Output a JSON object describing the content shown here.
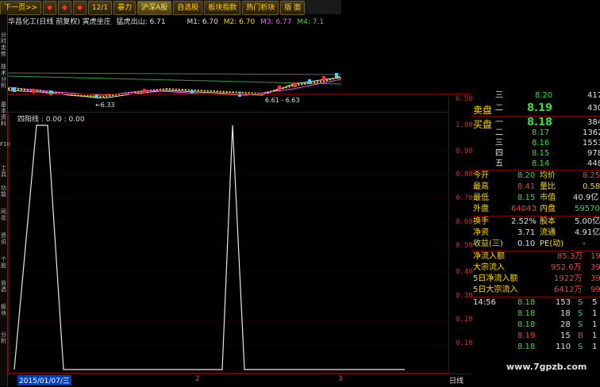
{
  "toolbar": {
    "items": [
      "下一页>>",
      "◆",
      "◆",
      "◆",
      "12/1",
      "暴力",
      "沪深A股",
      "自选股",
      "板块指数",
      "热门析块",
      "版 面"
    ]
  },
  "left_tabs": [
    "分时走势",
    "技术分析",
    "基本资料",
    "F10",
    "工具",
    "功能",
    "同花",
    "资讯",
    "个股",
    "自选",
    "板块",
    "分析"
  ],
  "chart_header": {
    "stock": "华昌化工(日线 前复权) 寅虎坐庄",
    "indicator": "猛虎出山: 6.71",
    "m1": "M1: 6.70",
    "m2": "M2: 6.70",
    "m3": "M3: 6.77",
    "m4": "M4: 7.1"
  },
  "price_axis": {
    "top": "6.50"
  },
  "annotations": {
    "low": "←6.33",
    "range": "6.61 - 6.63"
  },
  "lower_panel": {
    "title": "四阳线 : 0.00 : 0.00",
    "axis": [
      "1.00",
      "0.90",
      "0.80",
      "0.70",
      "0.60",
      "0.50",
      "0.40",
      "0.30",
      "0.20",
      "0.10"
    ],
    "date": "2015/01/07/三",
    "ticks": [
      "2",
      "3"
    ],
    "period": "日线"
  },
  "chart_data": {
    "type": "line",
    "series": [
      {
        "values": [
          0,
          1,
          1,
          0,
          0,
          0,
          0,
          0,
          0,
          1,
          0,
          0,
          0,
          0
        ]
      }
    ],
    "ylim": [
      0,
      1.0
    ]
  },
  "quote": {
    "sell_label": "卖盘",
    "buy_label": "买盘",
    "sell": [
      {
        "lvl": "三",
        "price": "8.20",
        "vol": "417"
      },
      {
        "lvl": "二",
        "price": "8.19",
        "vol": "430"
      }
    ],
    "buy": [
      {
        "lvl": "一",
        "price": "8.18",
        "vol": "384"
      },
      {
        "lvl": "二",
        "price": "8.17",
        "vol": "1362"
      },
      {
        "lvl": "三",
        "price": "8.16",
        "vol": "1553"
      },
      {
        "lvl": "四",
        "price": "8.15",
        "vol": "978"
      },
      {
        "lvl": "五",
        "price": "8.14",
        "vol": "448"
      }
    ],
    "stats": [
      {
        "k1": "今开",
        "v1": "8.20",
        "k2": "均价",
        "v2": "8.25"
      },
      {
        "k1": "最高",
        "v1": "8.41",
        "k2": "量比",
        "v2": "0.58"
      },
      {
        "k1": "最低",
        "v1": "8.15",
        "k2": "市值",
        "v2": "40.9亿"
      },
      {
        "k1": "外盘",
        "v1": "64043",
        "k2": "内盘",
        "v2": "59570"
      }
    ],
    "stats2": [
      {
        "k1": "换手",
        "v1": "2.52%",
        "k2": "股本",
        "v2": "5.00亿"
      },
      {
        "k1": "净资",
        "v1": "3.71",
        "k2": "流通",
        "v2": "4.91亿"
      },
      {
        "k1": "收益(三)",
        "v1": "0.10",
        "k2": "PE(动)",
        "v2": "-"
      }
    ],
    "flows": [
      {
        "k": "净流入额",
        "v": "85.3万",
        "r": "19"
      },
      {
        "k": "大宗流入",
        "v": "952.6万",
        "r": "39"
      },
      {
        "k": "5日净流入额",
        "v": "1922万",
        "r": "39"
      },
      {
        "k": "5日大宗流入",
        "v": "6412万",
        "r": "99"
      }
    ],
    "ticks": [
      {
        "t": "14:56",
        "p": "8.18",
        "v": "153",
        "d": "S",
        "x": "5"
      },
      {
        "t": "",
        "p": "8.18",
        "v": "18",
        "d": "S",
        "x": "1"
      },
      {
        "t": "",
        "p": "8.18",
        "v": "28",
        "d": "S",
        "x": "1"
      },
      {
        "t": "",
        "p": "8.19",
        "v": "15",
        "d": "B",
        "x": "1"
      },
      {
        "t": "",
        "p": "8.18",
        "v": "110",
        "d": "S",
        "x": "1"
      }
    ]
  },
  "watermark": "www.7gpzb.com"
}
